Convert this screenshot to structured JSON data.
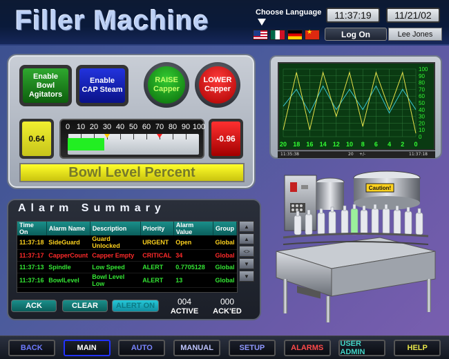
{
  "header": {
    "title": "Filler Machine",
    "language_label": "Choose Language",
    "languages": [
      "us-flag",
      "mexico-flag",
      "germany-flag",
      "china-flag"
    ],
    "time": "11:37:19",
    "date": "11/21/02",
    "logon_label": "Log On",
    "user": "Lee Jones"
  },
  "controls": {
    "agitators_label": "Enable\nBowl\nAgitators",
    "steam_label": "Enable\nCAP Steam",
    "raise_label": "RAISE\nCapper",
    "lower_label": "LOWER\nCapper",
    "left_value": "0.64",
    "right_value": "-0.96",
    "gauge_ticks": [
      "0",
      "10",
      "20",
      "30",
      "40",
      "50",
      "60",
      "70",
      "80",
      "90",
      "100"
    ],
    "gauge_fill_percent": 28,
    "gauge_marker_yellow": 30,
    "gauge_marker_red": 70,
    "bowl_level_label": "Bowl Level Percent"
  },
  "trend": {
    "y_ticks": [
      "100",
      "90",
      "80",
      "70",
      "60",
      "50",
      "40",
      "30",
      "20",
      "10",
      "0"
    ],
    "x_ticks": [
      "20",
      "18",
      "16",
      "14",
      "12",
      "10",
      "8",
      "6",
      "4",
      "2",
      "0"
    ],
    "footer_left": "11:35:38",
    "footer_mid": "20",
    "footer_plusminus": "+/-",
    "footer_right": "11:37:18",
    "colors": {
      "yellow": "#e8e24a",
      "cyan": "#39c4d0",
      "grid": "#2e7a3a",
      "ticks": "#33ff33"
    },
    "series_yellow": [
      10,
      95,
      10,
      95,
      30,
      95,
      15,
      95,
      40,
      95,
      5
    ],
    "series_cyan": [
      45,
      70,
      35,
      75,
      40,
      70,
      40,
      75,
      35,
      70,
      40
    ]
  },
  "alarm": {
    "title": "Alarm Summary",
    "columns": [
      "Time On",
      "Alarm Name",
      "Description",
      "Priority",
      "Alarm Value",
      "Group"
    ],
    "rows": [
      {
        "time": "11:37:18",
        "name": "SideGuard",
        "desc": "Guard Unlocked",
        "priority": "URGENT",
        "value": "Open",
        "group": "Global",
        "color": "#ffd21e"
      },
      {
        "time": "11:37:17",
        "name": "CapperCount",
        "desc": "Capper Empty",
        "priority": "CRITICAL",
        "value": "34",
        "group": "Global",
        "color": "#ff2a2a"
      },
      {
        "time": "11:37:13",
        "name": "Spindle",
        "desc": "Low Speed",
        "priority": "ALERT",
        "value": "0.7705128",
        "group": "Global",
        "color": "#34e634"
      },
      {
        "time": "11:37:16",
        "name": "BowlLevel",
        "desc": "Bowl Level Low",
        "priority": "ALERT",
        "value": "13",
        "group": "Global",
        "color": "#34e634"
      }
    ],
    "scroll_mid": "<>",
    "ack_label": "ACK",
    "clear_label": "CLEAR",
    "alarm_on_label": "ALERT ON",
    "active_count": "004",
    "active_label": "ACTIVE",
    "acked_count": "000",
    "acked_label": "ACK'ED"
  },
  "machine": {
    "caution_label": "Caution!"
  },
  "nav": [
    {
      "label": "BACK",
      "color": "#6e7bff",
      "border": "#555"
    },
    {
      "label": "MAIN",
      "color": "#ffffff",
      "border": "#2233ff"
    },
    {
      "label": "AUTO",
      "color": "#7a85ff",
      "border": "#555"
    },
    {
      "label": "MANUAL",
      "color": "#bfc6ff",
      "border": "#555"
    },
    {
      "label": "SETUP",
      "color": "#8f98ff",
      "border": "#555"
    },
    {
      "label": "ALARMS",
      "color": "#ff4a4a",
      "border": "#555"
    },
    {
      "label": "USER ADMIN",
      "color": "#43d4c6",
      "border": "#555"
    },
    {
      "label": "HELP",
      "color": "#e7e54a",
      "border": "#555"
    }
  ]
}
